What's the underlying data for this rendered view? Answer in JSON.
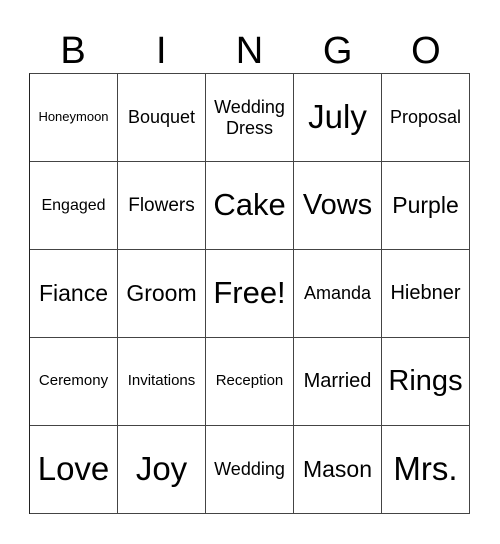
{
  "header": {
    "letters": [
      "B",
      "I",
      "N",
      "G",
      "O"
    ]
  },
  "board": {
    "rows": [
      [
        "Honeymoon",
        "Bouquet",
        "Wedding Dress",
        "July",
        "Proposal"
      ],
      [
        "Engaged",
        "Flowers",
        "Cake",
        "Vows",
        "Purple"
      ],
      [
        "Fiance",
        "Groom",
        "Free!",
        "Amanda",
        "Hiebner"
      ],
      [
        "Ceremony",
        "Invitations",
        "Reception",
        "Married",
        "Rings"
      ],
      [
        "Love",
        "Joy",
        "Wedding",
        "Mason",
        "Mrs."
      ]
    ]
  }
}
